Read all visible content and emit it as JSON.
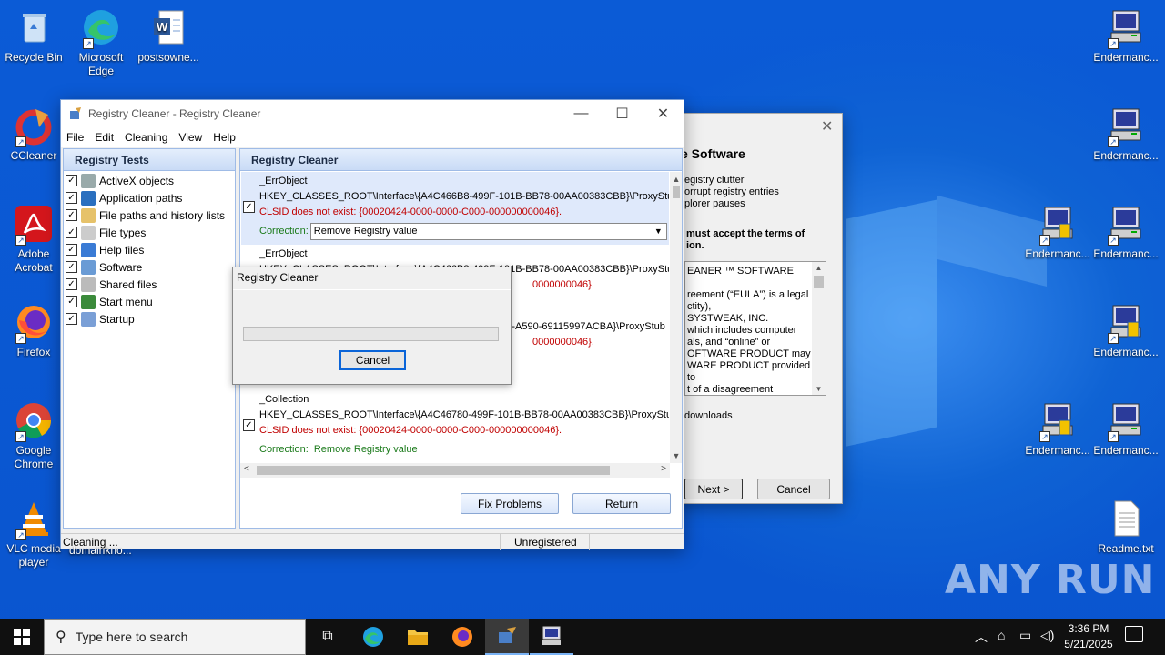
{
  "desktop": {
    "icons_left": [
      {
        "label": "Recycle Bin"
      },
      {
        "label": "Microsoft Edge"
      },
      {
        "label": "postsowne..."
      },
      {
        "label": "CCleaner"
      },
      {
        "label": "Adobe Acrobat"
      },
      {
        "label": "Firefox"
      },
      {
        "label": "Google Chrome"
      },
      {
        "label": "VLC media player"
      }
    ],
    "icons_right": [
      {
        "label": "Endermanc..."
      },
      {
        "label": "Endermanc..."
      },
      {
        "label": "Endermanc..."
      },
      {
        "label": "Endermanc..."
      },
      {
        "label": "Endermanc..."
      },
      {
        "label": "Endermanc..."
      },
      {
        "label": "Endermanc..."
      },
      {
        "label": "Endermanc..."
      },
      {
        "label": "Readme.txt"
      }
    ],
    "hidden_label": "domainkno...",
    "watermark": "ANY RUN"
  },
  "main_window": {
    "title": "Registry Cleaner - Registry Cleaner",
    "menu": [
      "File",
      "Edit",
      "Cleaning",
      "View",
      "Help"
    ],
    "tests_header": "Registry Tests",
    "tests": [
      "ActiveX objects",
      "Application paths",
      "File paths and history lists",
      "File types",
      "Help files",
      "Software",
      "Shared files",
      "Start menu",
      "Startup"
    ],
    "results_header": "Registry Cleaner",
    "entries": [
      {
        "name": "_ErrObject",
        "key": "HKEY_CLASSES_ROOT\\Interface\\{A4C466B8-499F-101B-BB78-00AA00383CBB}\\ProxyStub",
        "error": "CLSID does not exist: {00020424-0000-0000-C000-000000000046}.",
        "correction_label": "Correction:",
        "correction_value": "Remove Registry value"
      },
      {
        "name": "_ErrObject",
        "key": "HKEY_CLASSES_ROOT\\Interface\\{A4C466B8-499F-101B-BB78-00AA00383CBB}\\ProxyStub",
        "error": "0000000046}."
      },
      {
        "name": "",
        "key": "A-A590-69115997ACBA}\\ProxyStub",
        "error": "0000000046}."
      },
      {
        "name": "_Collection",
        "key": "HKEY_CLASSES_ROOT\\Interface\\{A4C46780-499F-101B-BB78-00AA00383CBB}\\ProxyStub",
        "error": "CLSID does not exist: {00020424-0000-0000-C000-000000000046}.",
        "correction_label": "Correction:",
        "correction_value": "Remove Registry value"
      }
    ],
    "fix_button": "Fix Problems",
    "return_button": "Return",
    "status_left": "Cleaning ...",
    "status_mid": "Unregistered"
  },
  "progress_dialog": {
    "title": "Registry Cleaner",
    "progress": 0,
    "cancel_button": "Cancel"
  },
  "installer": {
    "heading": "e Software",
    "bullets": [
      "egistry clutter",
      "orrupt registry entries",
      "plorer pauses"
    ],
    "accept_text": "must accept the terms of\nion.",
    "eula_lines": [
      "EANER ™ SOFTWARE",
      "",
      "reement (“EULA”) is a legal",
      "ctity),",
      "SYSTWEAK, INC.",
      "which includes computer",
      "als, and “online” or",
      "OFTWARE PRODUCT may",
      "WARE PRODUCT provided to",
      "t of a disagreement"
    ],
    "downloads": "downloads",
    "next_button": "Next >",
    "cancel_button": "Cancel"
  },
  "taskbar": {
    "search_placeholder": "Type here to search",
    "time": "3:36 PM",
    "date": "5/21/2025"
  }
}
